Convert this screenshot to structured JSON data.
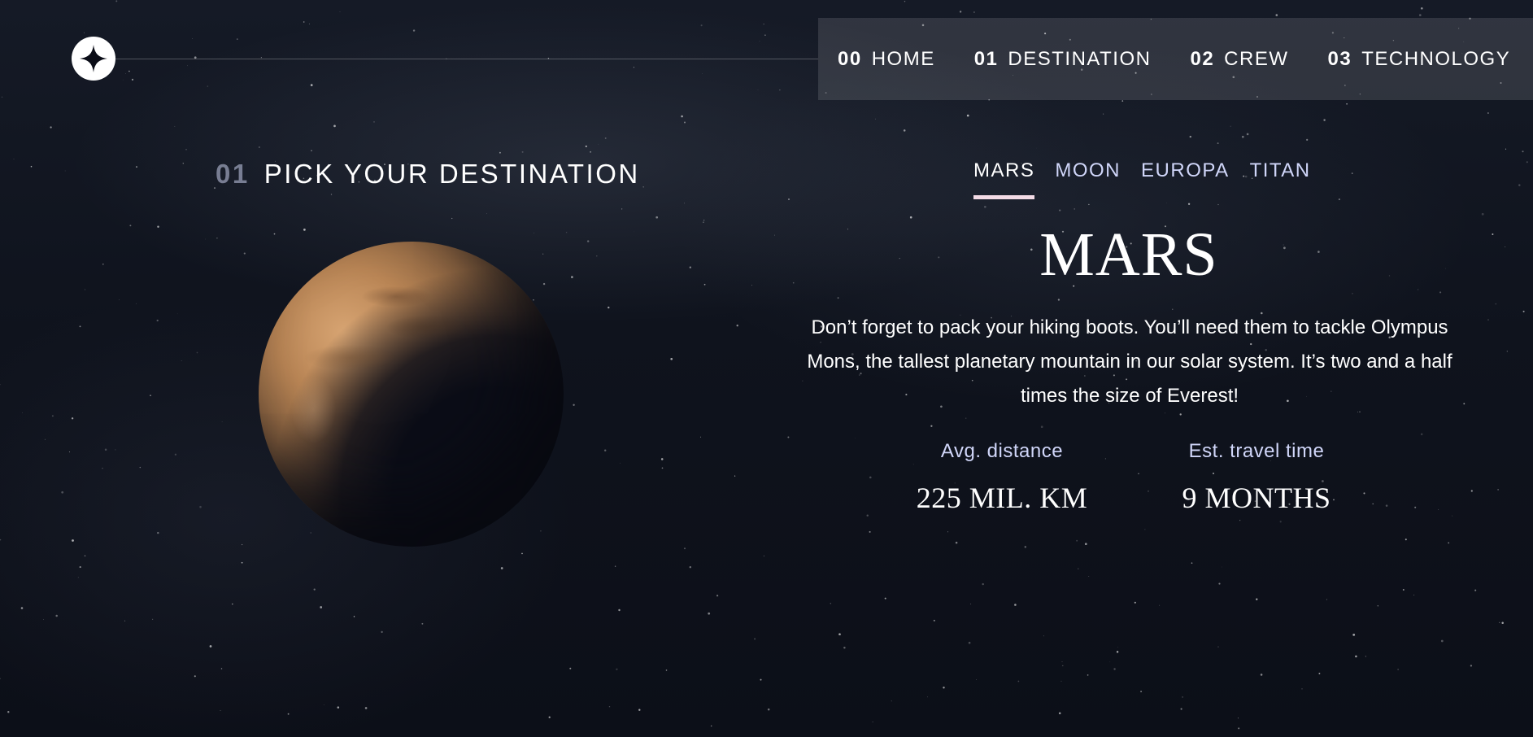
{
  "header": {
    "logo_icon": "star-logo-icon",
    "nav": [
      {
        "num": "00",
        "label": "HOME"
      },
      {
        "num": "01",
        "label": "DESTINATION"
      },
      {
        "num": "02",
        "label": "CREW"
      },
      {
        "num": "03",
        "label": "TECHNOLOGY"
      }
    ]
  },
  "page": {
    "heading_num": "01",
    "heading_text": "PICK YOUR DESTINATION",
    "planet_image": "mars-planet-image"
  },
  "tabs": [
    {
      "label": "MARS",
      "active": true
    },
    {
      "label": "MOON",
      "active": false
    },
    {
      "label": "EUROPA",
      "active": false
    },
    {
      "label": "TITAN",
      "active": false
    }
  ],
  "destination": {
    "name": "MARS",
    "description": "Don’t forget to pack your hiking boots. You’ll need them to tackle Olympus Mons, the tallest planetary mountain in our solar system. It’s two and a half times the size of Everest!",
    "stats": {
      "distance_label": "Avg. distance",
      "distance_value": "225 MIL. KM",
      "travel_label": "Est. travel time",
      "travel_value": "9 MONTHS"
    }
  },
  "colors": {
    "background": "#0b0d17",
    "accent_light": "#d0d6f9",
    "tab_underline": "#f3dbe6",
    "white": "#ffffff"
  }
}
